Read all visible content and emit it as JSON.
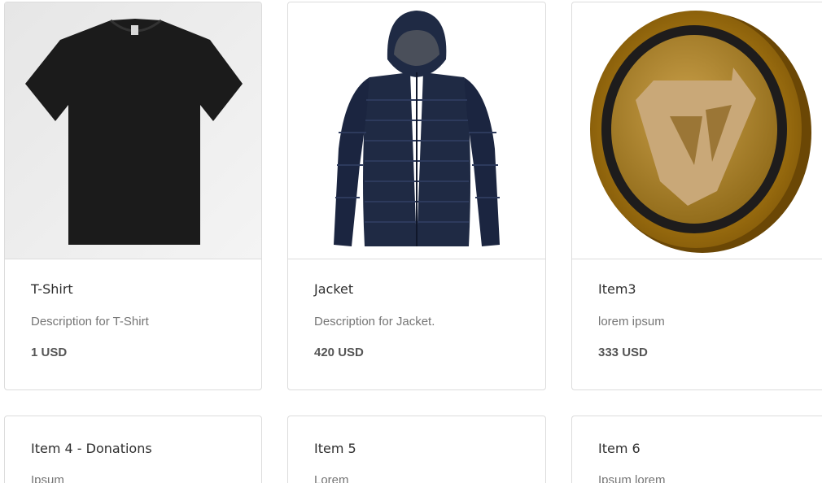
{
  "products": [
    {
      "title": "T-Shirt",
      "description": "Description for T-Shirt",
      "price": "1 USD",
      "image_icon": "tshirt-image"
    },
    {
      "title": "Jacket",
      "description": "Description for Jacket.",
      "price": "420 USD",
      "image_icon": "jacket-image"
    },
    {
      "title": "Item3",
      "description": "lorem ipsum",
      "price": "333 USD",
      "image_icon": "coin-image"
    },
    {
      "title": "Item 4 - Donations",
      "description": "Ipsum"
    },
    {
      "title": "Item 5",
      "description": "Lorem"
    },
    {
      "title": "Item 6",
      "description": "Ipsum lorem"
    }
  ],
  "colors": {
    "border": "#dcdcdc",
    "title": "#2f2f2f",
    "description": "#757575",
    "price": "#555555",
    "coin_gold": "#b8860b",
    "jacket_navy": "#1f2a44"
  }
}
